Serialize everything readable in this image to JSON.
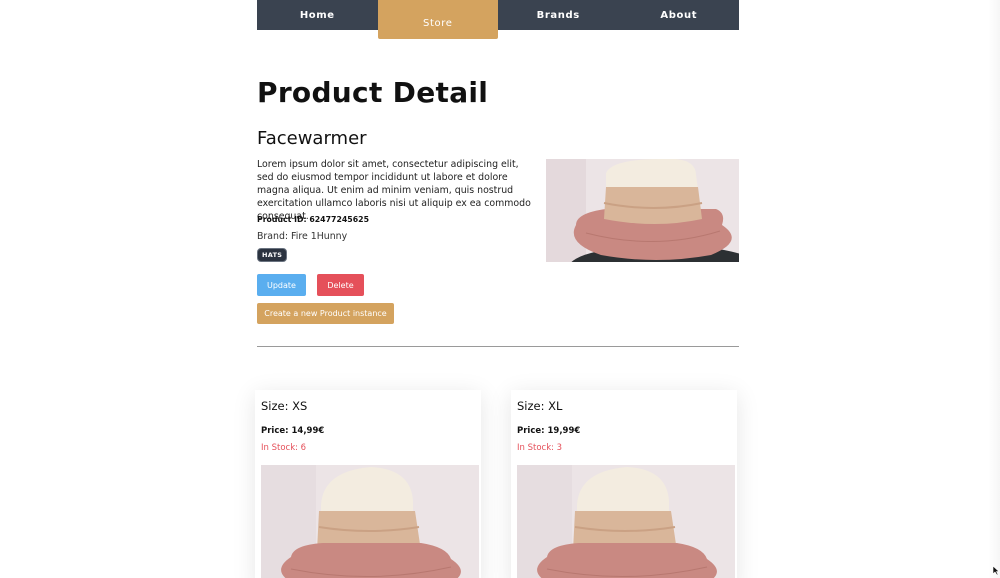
{
  "nav": {
    "items": [
      {
        "label": "Home",
        "active": false
      },
      {
        "label": "Store",
        "active": true
      },
      {
        "label": "Brands",
        "active": false
      },
      {
        "label": "About",
        "active": false
      }
    ]
  },
  "page": {
    "title": "Product Detail"
  },
  "product": {
    "name": "Facewarmer",
    "description": "Lorem ipsum dolor sit amet, consectetur adipiscing elit, sed do eiusmod tempor incididunt ut labore et dolore magna aliqua. Ut enim ad minim veniam, quis nostrud exercitation ullamco laboris nisi ut aliquip ex ea commodo consequat.",
    "id_label": "Product ID: 62477245625",
    "brand_label": "Brand: Fire 1Hunny",
    "category_badge": "HATS"
  },
  "actions": {
    "update_label": "Update",
    "delete_label": "Delete",
    "create_label": "Create a new Product instance"
  },
  "instances": [
    {
      "size_label": "Size: XS",
      "price_label": "Price: 14,99€",
      "stock_label": "In Stock: 6"
    },
    {
      "size_label": "Size: XL",
      "price_label": "Price: 19,99€",
      "stock_label": "In Stock: 3"
    }
  ],
  "colors": {
    "nav_bg": "#3a4350",
    "accent": "#d4a35f",
    "update": "#5aaeef",
    "delete": "#e5505a",
    "stock_text": "#e5505a"
  },
  "icons": {
    "product_image": "pink-sun-hat-photo"
  }
}
